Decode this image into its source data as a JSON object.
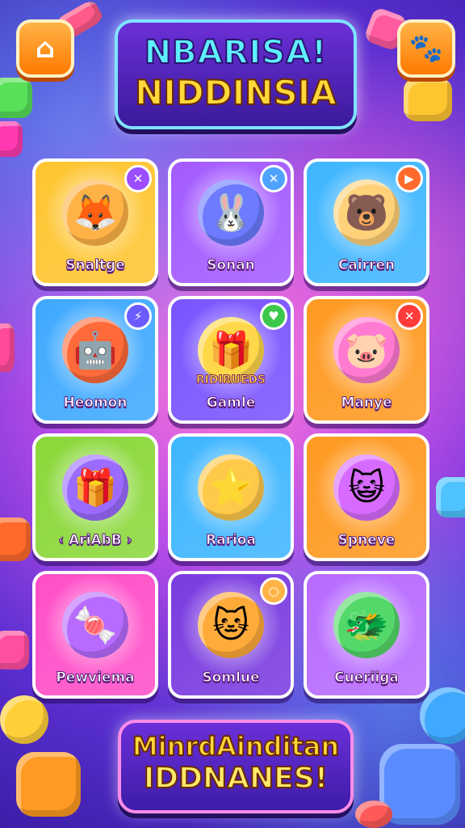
{
  "header": {
    "title_line1": "NBARISA!",
    "title_line2": "NIDDINSIA",
    "home_icon": "home-icon",
    "settings_icon": "pet-settings-icon"
  },
  "tiles": [
    {
      "label": "Snaltge",
      "icon": "fox-character",
      "badge": "✕",
      "badge_color": "#9b4dff",
      "bg": "#ffc531"
    },
    {
      "label": "Sonan",
      "icon": "blue-bunny-character",
      "badge": "✕",
      "badge_color": "#4fa3ff",
      "bg": "#a45bff"
    },
    {
      "label": "Cairren",
      "icon": "bear-character",
      "badge": "▶",
      "badge_color": "#ff6a2b",
      "bg": "#3fb6ff"
    },
    {
      "label": "Heomon",
      "icon": "robot-character",
      "badge": "⚡",
      "badge_color": "#6a5bff",
      "bg": "#3fa9ff"
    },
    {
      "label": "Gamle",
      "sublabel": "RIDIRUEDS",
      "icon": "treasure-box",
      "badge": "♥",
      "badge_color": "#3cc84a",
      "bg": "#7a54ff"
    },
    {
      "label": "Manye",
      "icon": "pink-creature",
      "badge": "✕",
      "badge_color": "#ff3a3a",
      "bg": "#ff9a22"
    },
    {
      "label": "‹ AriAbB ›",
      "icon": "gift-box",
      "badge": "",
      "badge_color": "#7ad84a",
      "bg": "#8ad83a"
    },
    {
      "label": "Rarioa",
      "icon": "star-fox-character",
      "badge": "",
      "badge_color": "#3fb6ff",
      "bg": "#3fb6ff"
    },
    {
      "label": "Spneve",
      "icon": "purple-cat-character",
      "badge": "",
      "badge_color": "#ff9a22",
      "bg": "#ff9a22"
    },
    {
      "label": "Pewviema",
      "icon": "candy-character",
      "badge": "",
      "badge_color": "#ff4fc8",
      "bg": "#ff4fc8"
    },
    {
      "label": "Somlue",
      "icon": "orange-cat-character",
      "badge": "○",
      "badge_color": "#ffb347",
      "bg": "#7a3be0"
    },
    {
      "label": "Cueriiga",
      "icon": "green-dragon-character",
      "badge": "",
      "badge_color": "#b86bff",
      "bg": "#b86bff"
    }
  ],
  "footer": {
    "line1": "MinrdAinditan",
    "line2": "IDDNANES!"
  }
}
